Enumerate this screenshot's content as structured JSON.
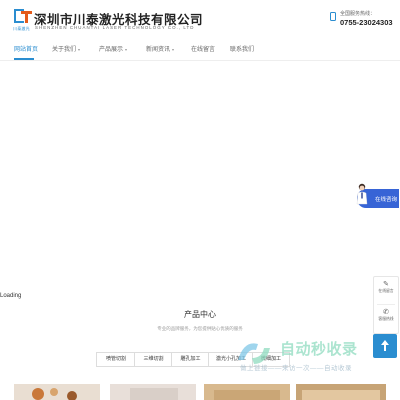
{
  "header": {
    "company_name": "深圳市川泰激光科技有限公司",
    "company_name_en": "SHENZHEN CHUANTAI LASER TECHNOLOGY CO., LTD",
    "logo_sub": "川泰激光",
    "hotline_label": "全国服务热线：",
    "hotline_number": "0755-23024303",
    "phone_icon": "phone-icon"
  },
  "nav": {
    "items": [
      {
        "label": "网站首页",
        "active": true
      },
      {
        "label": "关于我们",
        "dropdown": true
      },
      {
        "label": "产品展示",
        "dropdown": true
      },
      {
        "label": "新闻资讯",
        "dropdown": true
      },
      {
        "label": "在线留言"
      },
      {
        "label": "联系我们"
      }
    ]
  },
  "float_bubble": {
    "label": "在线咨询"
  },
  "loading_text": "Loading",
  "side_panel": {
    "items": [
      {
        "icon": "chat-icon",
        "label": "在线留言"
      },
      {
        "icon": "phone-icon",
        "label": "客服热线"
      }
    ],
    "back_to_top_icon": "arrow-up-icon"
  },
  "products_section": {
    "title": "产品中心",
    "subtitle": "专业的品牌服务，为您提供贴心优质的服务",
    "tabs": [
      "喷管切割",
      "三维切割",
      "雕孔加工",
      "激光小孔加工",
      "微细加工"
    ]
  },
  "watermark": {
    "title": "自动秒收录",
    "subtitle": "做上链接——来访一次——自动收录"
  },
  "colors": {
    "accent": "#2a8dd0",
    "brand_orange": "#e45b1b",
    "bubble": "#3764d6"
  }
}
